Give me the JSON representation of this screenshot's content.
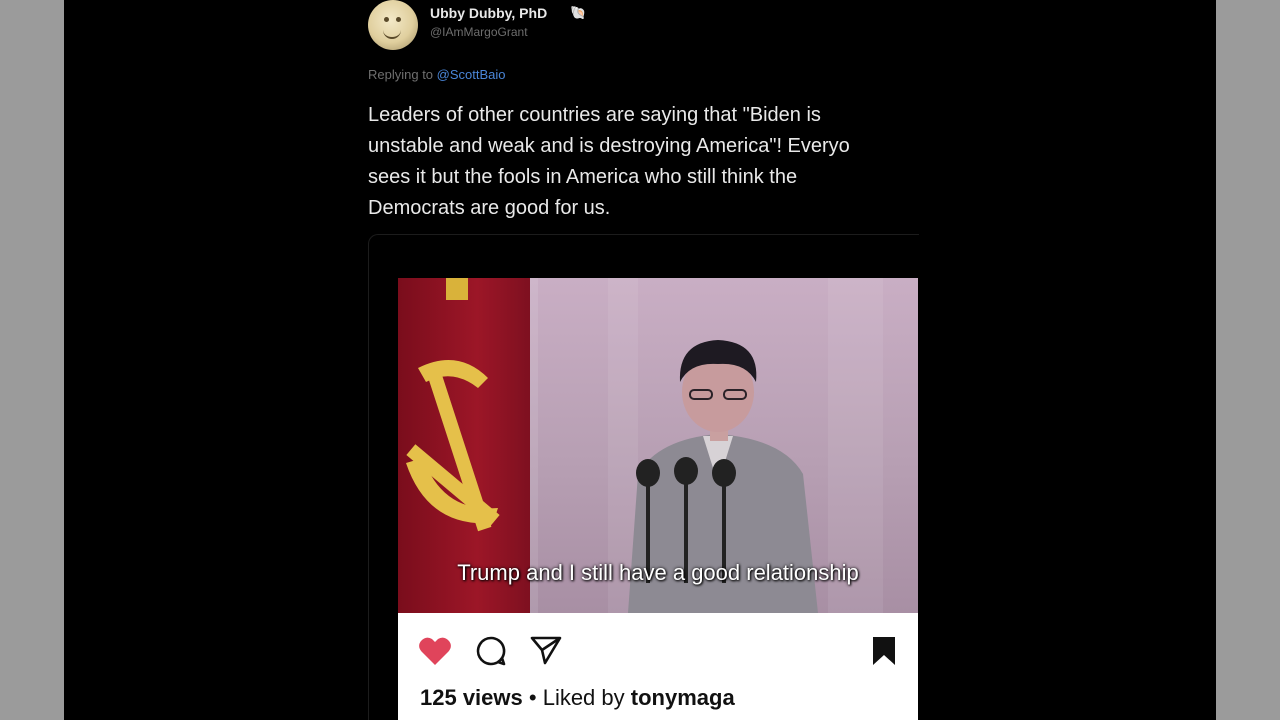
{
  "tweet": {
    "author": {
      "display_name": "Ubby Dubby, PhD",
      "badge_icon": "emoji-badge-icon",
      "handle": "@IAmMargoGrant"
    },
    "replying_to": {
      "prefix": "Replying to",
      "mention": "@ScottBaio"
    },
    "text_lines": [
      "Leaders of other countries are saying that \"Biden is",
      "unstable and weak and is destroying America\"! Everyo",
      "sees it but the fools in America who still think the",
      "Democrats are good for us."
    ]
  },
  "embedded_post": {
    "video_subtitle": "Trump and I still have a good relationship",
    "icons": [
      "heart-icon",
      "comment-icon",
      "send-icon",
      "bookmark-icon"
    ],
    "views_count": "125 views",
    "separator": "•",
    "liked_by_prefix": "Liked by",
    "liked_by_user": "tonymaga"
  },
  "colors": {
    "background": "#000000",
    "side_bars": "#9b9b9b",
    "mention": "#4a86d8",
    "like": "#e0445b",
    "text": "#e9e9e9"
  }
}
